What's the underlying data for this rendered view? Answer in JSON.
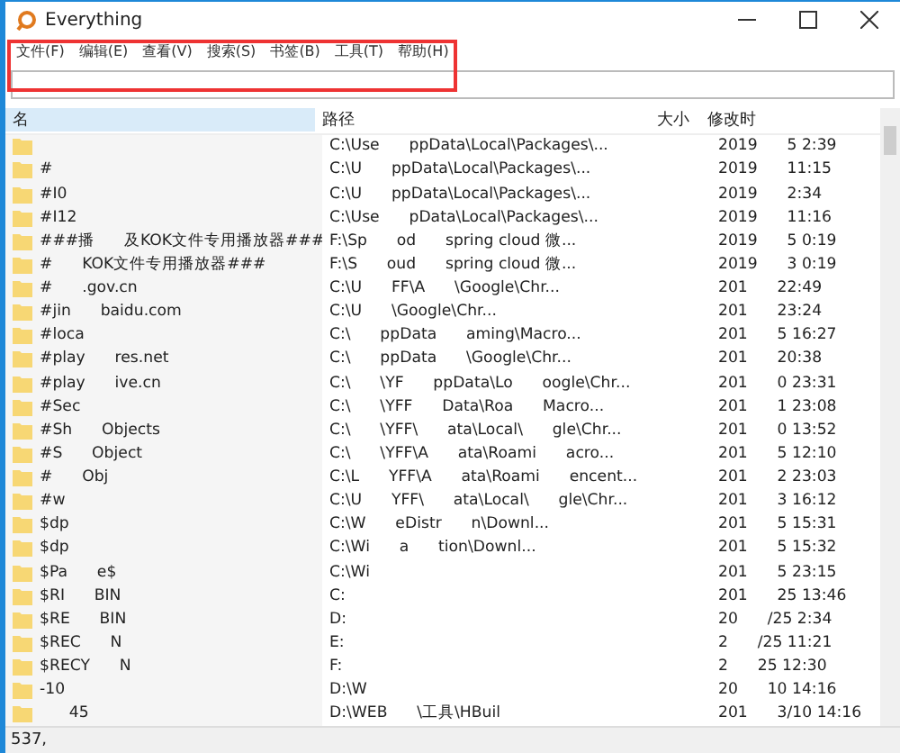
{
  "window": {
    "title": "Everything"
  },
  "menu": [
    "文件(F)",
    "编辑(E)",
    "查看(V)",
    "搜索(S)",
    "书签(B)",
    "工具(T)",
    "帮助(H)"
  ],
  "table": {
    "columns": [
      "名",
      "路径",
      "大小",
      "修改时"
    ],
    "rows": [
      {
        "path": "C:\\Use      ppData\\Local\\Packages\\...",
        "modified": "2019      5 2:39"
      },
      {
        "name": "#",
        "path": "C:\\U      ppData\\Local\\Packages\\...",
        "modified": "2019      11:15"
      },
      {
        "name": "#I0",
        "path": "C:\\U      ppData\\Local\\Packages\\...",
        "modified": "2019      2:34"
      },
      {
        "name": "#I12",
        "path": "C:\\Use      pData\\Local\\Packages\\...",
        "modified": "2019      11:16"
      },
      {
        "name": "###播      及KOK文件专用播放器###",
        "path": "F:\\Sp      od      spring cloud 微...",
        "modified": "2019      5 0:19"
      },
      {
        "name": "#      KOK文件专用播放器###",
        "path": "F:\\S      oud      spring cloud 微...",
        "modified": "2019      3 0:19"
      },
      {
        "name": "#      .gov.cn",
        "path": "C:\\U      FF\\A      \\Google\\Chr...",
        "modified": "201      22:49"
      },
      {
        "name": "#jin      baidu.com",
        "path": "C:\\U      \\Google\\Chr...",
        "modified": "201      23:24"
      },
      {
        "name": "#loca",
        "path": "C:\\      ppData      aming\\Macro...",
        "modified": "201      5 16:27"
      },
      {
        "name": "#play      res.net",
        "path": "C:\\      ppData      \\Google\\Chr...",
        "modified": "201      20:38"
      },
      {
        "name": "#play      ive.cn",
        "path": "C:\\      \\YF      ppData\\Lo      oogle\\Chr...",
        "modified": "201      0 23:31"
      },
      {
        "name": "#Sec",
        "path": "C:\\      \\YFF      Data\\Roa      Macro...",
        "modified": "201      1 23:08"
      },
      {
        "name": "#Sh      Objects",
        "path": "C:\\      \\YFF\\      ata\\Local\\      gle\\Chr...",
        "modified": "201      0 13:52"
      },
      {
        "name": "#S      Object",
        "path": "C:\\      \\YFF\\A      ata\\Roami      acro...",
        "modified": "201      5 12:10"
      },
      {
        "name": "#      Obj",
        "path": "C:\\L      YFF\\A      ata\\Roami      encent...",
        "modified": "201      2 23:03"
      },
      {
        "name": "#w",
        "path": "C:\\U      YFF\\      ata\\Local\\      gle\\Chr...",
        "modified": "201      3 16:12"
      },
      {
        "name": "$dp",
        "path": "C:\\W      eDistr      n\\Downl...",
        "modified": "201      5 15:31"
      },
      {
        "name": "$dp",
        "path": "C:\\Wi      a      tion\\Downl...",
        "modified": "201      5 15:32"
      },
      {
        "name": "$Pa      e$",
        "path": "C:\\Wi",
        "modified": "201      5 23:15"
      },
      {
        "name": "$RI      BIN",
        "path": "C:",
        "modified": "201      25 13:46"
      },
      {
        "name": "$RE      BIN",
        "path": "D:",
        "modified": "20      /25 2:34"
      },
      {
        "name": "$REC      N",
        "path": "E:",
        "modified": "2      /25 11:21"
      },
      {
        "name": "$RECY      N",
        "path": "F:",
        "modified": "2      25 12:30"
      },
      {
        "name": "-10",
        "path": "D:\\W",
        "modified": "20      10 14:16"
      },
      {
        "name": "      45",
        "path": "D:\\WEB      \\工具\\HBuil",
        "modified": "201      3/10 14:16"
      }
    ]
  },
  "status_bar": "537,"
}
